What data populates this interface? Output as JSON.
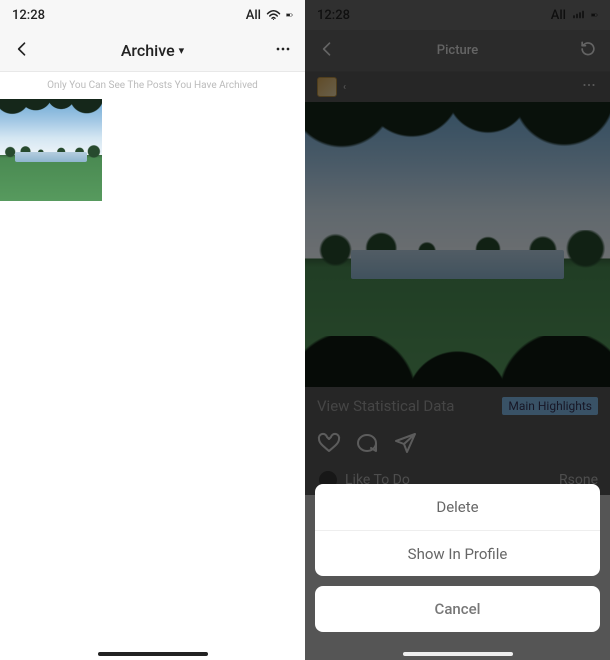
{
  "left_screen": {
    "status_bar": {
      "time": "12:28",
      "right_text": "All"
    },
    "header": {
      "title": "Archive"
    },
    "hint": "Only You Can See The Posts You Have Archived",
    "grid": {
      "thumbnails": [
        {
          "name": "archived-photo-1"
        }
      ]
    }
  },
  "right_screen": {
    "status_bar": {
      "time": "12:28",
      "right_text": "All"
    },
    "header": {
      "title": "Picture"
    },
    "post": {
      "stats_label": "View Statistical Data",
      "highlight_label": "Main Highlights",
      "like_label": "Like To Do",
      "username": "Rsone"
    },
    "action_sheet": {
      "items": [
        {
          "label": "Delete",
          "name": "delete-button"
        },
        {
          "label": "Show In Profile",
          "name": "show-in-profile-button"
        }
      ],
      "cancel_label": "Cancel"
    }
  }
}
